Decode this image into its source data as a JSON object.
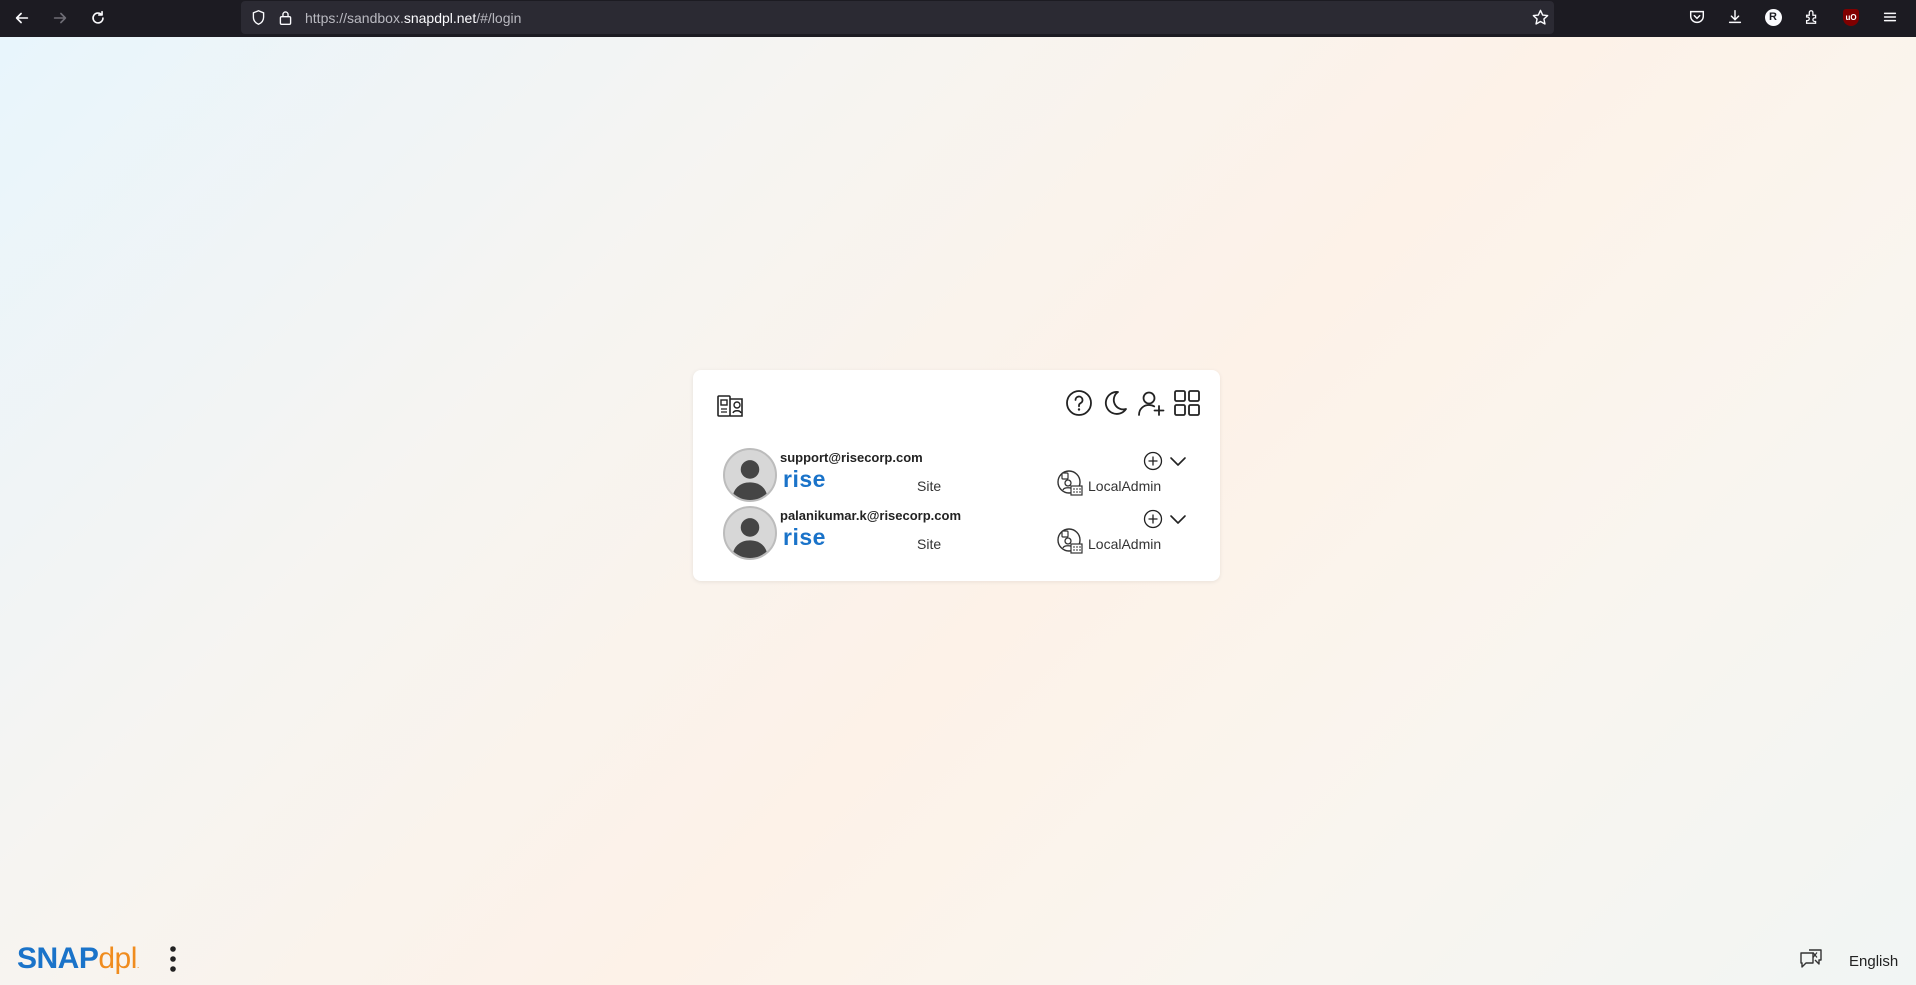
{
  "browser": {
    "url_prefix": "https://sandbox.",
    "url_host": "snapdpl.net",
    "url_path": "/#/login",
    "profile_initial": "R",
    "addon_label": "uO"
  },
  "toolbar_icons": [
    "help-icon",
    "dark-mode-icon",
    "add-user-icon",
    "apps-grid-icon"
  ],
  "accounts": [
    {
      "email": "support@risecorp.com",
      "org": "rise",
      "type": "Site",
      "role": "LocalAdmin"
    },
    {
      "email": "palanikumar.k@risecorp.com",
      "org": "rise",
      "type": "Site",
      "role": "LocalAdmin"
    }
  ],
  "footer": {
    "logo_main": "SNAP",
    "logo_sub": "dpl",
    "logo_mark": ".",
    "language": "English"
  },
  "colors": {
    "brand_blue": "#1a73c9",
    "brand_orange": "#f08c1e"
  }
}
